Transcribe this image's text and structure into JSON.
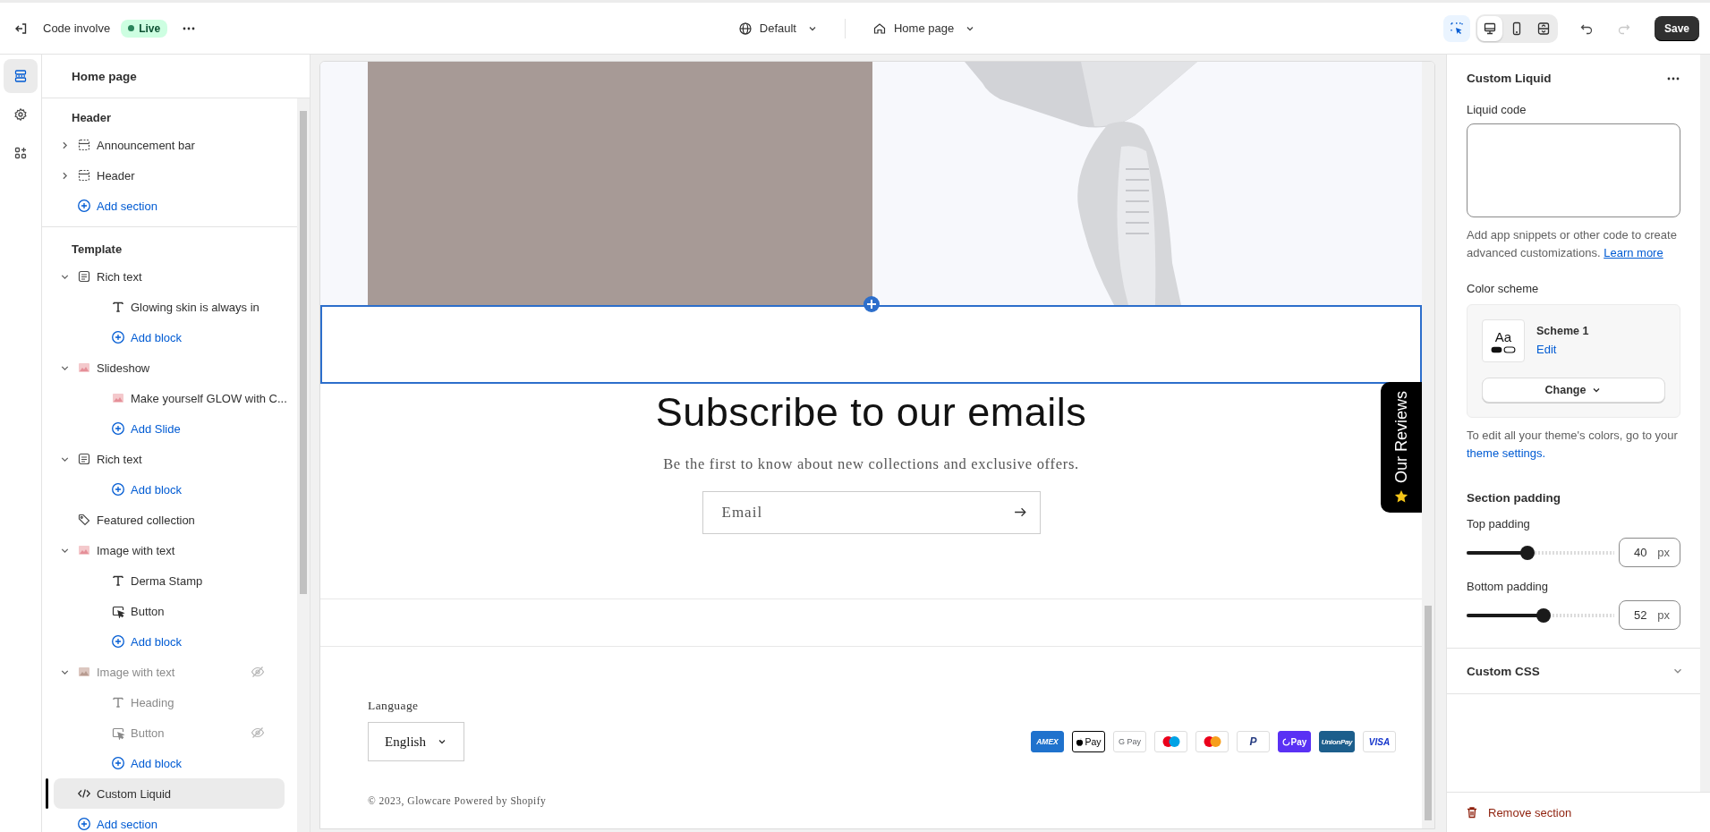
{
  "topbar": {
    "store_name": "Code involve",
    "status": "Live",
    "view": "Default",
    "page": "Home page",
    "save": "Save",
    "inspector_selected": true,
    "devices": [
      {
        "kind": "desktop",
        "selected": true
      },
      {
        "kind": "mobile",
        "selected": false
      },
      {
        "kind": "fullwidth",
        "selected": false
      }
    ]
  },
  "rail": [
    {
      "kind": "sections",
      "selected": true
    },
    {
      "kind": "settings",
      "selected": false
    },
    {
      "kind": "apps",
      "selected": false
    }
  ],
  "sidebar": {
    "title": "Home page",
    "groups": [
      {
        "title": "Header",
        "items": [
          {
            "kind": "layout",
            "label": "Announcement bar",
            "expanded": false,
            "hidden": false,
            "selected": false
          },
          {
            "kind": "layout",
            "label": "Header",
            "expanded": false,
            "hidden": false,
            "selected": false
          },
          {
            "kind": "add",
            "label": "Add section"
          }
        ]
      },
      {
        "title": "Template",
        "items": [
          {
            "kind": "richtext",
            "label": "Rich text",
            "expanded": true,
            "hidden": false,
            "selected": false,
            "children": [
              {
                "kind": "text",
                "label": "Glowing skin is always in",
                "hidden": false
              },
              {
                "kind": "add",
                "label": "Add block"
              }
            ]
          },
          {
            "kind": "media",
            "label": "Slideshow",
            "expanded": true,
            "hidden": false,
            "selected": false,
            "children": [
              {
                "kind": "media",
                "label": "Make yourself GLOW with C...",
                "hidden": false
              },
              {
                "kind": "add",
                "label": "Add Slide"
              }
            ]
          },
          {
            "kind": "richtext",
            "label": "Rich text",
            "expanded": true,
            "hidden": false,
            "selected": false,
            "children": [
              {
                "kind": "add",
                "label": "Add block"
              }
            ]
          },
          {
            "kind": "collection",
            "label": "Featured collection",
            "hidden": false,
            "selected": false
          },
          {
            "kind": "media",
            "label": "Image with text",
            "expanded": true,
            "hidden": false,
            "selected": false,
            "children": [
              {
                "kind": "text",
                "label": "Derma Stamp",
                "hidden": false
              },
              {
                "kind": "button",
                "label": "Button",
                "hidden": false
              },
              {
                "kind": "add",
                "label": "Add block"
              }
            ]
          },
          {
            "kind": "media",
            "label": "Image with text",
            "expanded": true,
            "hidden": true,
            "selected": false,
            "children": [
              {
                "kind": "text",
                "label": "Heading",
                "hidden": false
              },
              {
                "kind": "button",
                "label": "Button",
                "hidden": true
              },
              {
                "kind": "add",
                "label": "Add block"
              }
            ]
          },
          {
            "kind": "liquid",
            "label": "Custom Liquid",
            "hidden": false,
            "selected": true
          },
          {
            "kind": "add",
            "label": "Add section"
          }
        ]
      }
    ]
  },
  "preview": {
    "subscribe": {
      "heading": "Subscribe to our emails",
      "text": "Be the first to know about new collections and exclusive offers.",
      "email_placeholder": "Email"
    },
    "reviews_tab": "Our Reviews",
    "footer": {
      "language_label": "Language",
      "language": "English",
      "copyright": "© 2023, Glowcare Powered by Shopify",
      "payments": [
        {
          "kind": "amex",
          "label": "AMEX"
        },
        {
          "kind": "apple",
          "label": "Pay"
        },
        {
          "kind": "google",
          "label": "G Pay"
        },
        {
          "kind": "maestro"
        },
        {
          "kind": "mastercard"
        },
        {
          "kind": "paypal",
          "label": "P"
        },
        {
          "kind": "shop",
          "label": "Pay"
        },
        {
          "kind": "unionpay",
          "label": "UnionPay"
        },
        {
          "kind": "visa",
          "label": "VISA"
        }
      ]
    }
  },
  "settings": {
    "title": "Custom Liquid",
    "liquid_label": "Liquid code",
    "help": "Add app snippets or other code to create advanced customizations.",
    "help_link": "Learn more",
    "color_scheme": {
      "label": "Color scheme",
      "sample": "Aa",
      "name": "Scheme 1",
      "edit": "Edit",
      "change": "Change",
      "help": "To edit all your theme's colors, go to your",
      "link": "theme settings."
    },
    "padding": {
      "title": "Section padding",
      "sliders": [
        {
          "label": "Top padding",
          "level": 0.41,
          "value": "40",
          "unit": "px"
        },
        {
          "label": "Bottom padding",
          "level": 0.52,
          "value": "52",
          "unit": "px"
        }
      ]
    },
    "custom_css": {
      "label": "Custom CSS",
      "expanded": false
    },
    "remove": "Remove section"
  }
}
